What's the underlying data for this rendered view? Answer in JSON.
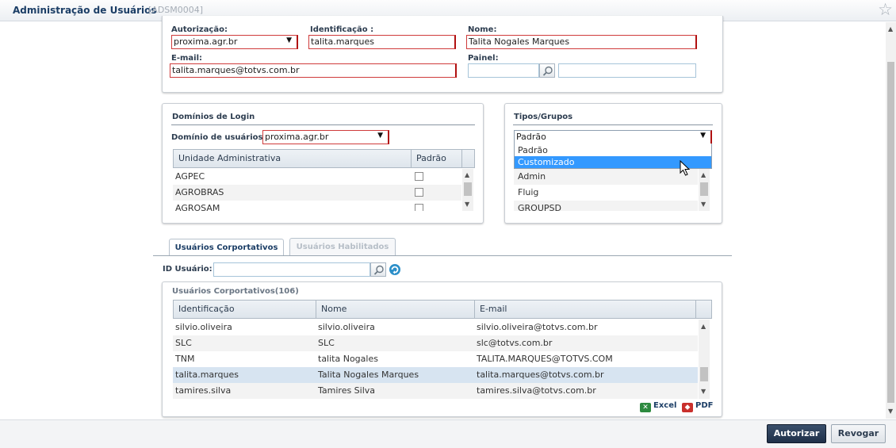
{
  "window": {
    "title": "Administração de Usuários",
    "code": "[ADSM0004]"
  },
  "user_form": {
    "autorizacao": {
      "label": "Autorização:",
      "value": "proxima.agr.br"
    },
    "identificacao": {
      "label": "Identificação :",
      "value": "talita.marques"
    },
    "nome": {
      "label": "Nome:",
      "value": "Talita Nogales Marques"
    },
    "email": {
      "label": "E-mail:",
      "value": "talita.marques@totvs.com.br"
    },
    "painel": {
      "label": "Painel:",
      "value": "",
      "description": ""
    }
  },
  "dominios": {
    "title": "Domínios de Login",
    "dominio_label": "Domínio de usuários:",
    "dominio_value": "proxima.agr.br",
    "columns": [
      "Unidade Administrativa",
      "Padrão"
    ],
    "rows": [
      {
        "unidade": "AGPEC"
      },
      {
        "unidade": "AGROBRAS"
      },
      {
        "unidade": "AGROSAM"
      }
    ]
  },
  "tipos": {
    "title": "Tipos/Grupos",
    "selected": "Padrão",
    "options": [
      "Padrão",
      "Customizado"
    ],
    "hovered_option": "Customizado",
    "groups": [
      "Admin",
      "Fluig",
      "GROUPSD"
    ]
  },
  "tabs": [
    {
      "label": "Usuários Corportativos",
      "active": true
    },
    {
      "label": "Usuários Habilitados",
      "active": false
    }
  ],
  "search": {
    "label": "ID Usuário:",
    "value": ""
  },
  "users": {
    "title": "Usuários Corportativos(106)",
    "columns": [
      "Identificação",
      "Nome",
      "E-mail"
    ],
    "rows": [
      {
        "id": "silvio.oliveira",
        "nome": "silvio.oliveira",
        "email": "silvio.oliveira@totvs.com.br"
      },
      {
        "id": "SLC",
        "nome": "SLC",
        "email": "slc@totvs.com.br"
      },
      {
        "id": "TNM",
        "nome": "talita Nogales",
        "email": "TALITA.MARQUES@TOTVS.COM"
      },
      {
        "id": "talita.marques",
        "nome": "Talita Nogales Marques",
        "email": "talita.marques@totvs.com.br"
      },
      {
        "id": "tamires.silva",
        "nome": "Tamires Silva",
        "email": "tamires.silva@totvs.com.br"
      }
    ],
    "selected_row": 3
  },
  "export": {
    "excel": "Excel",
    "pdf": "PDF"
  },
  "footer": {
    "autorizar": "Autorizar",
    "revogar": "Revogar"
  },
  "colors": {
    "brand": "#1c3e66",
    "required": "#b01010",
    "selection": "#d7e4f1",
    "hover": "#3399ff"
  }
}
